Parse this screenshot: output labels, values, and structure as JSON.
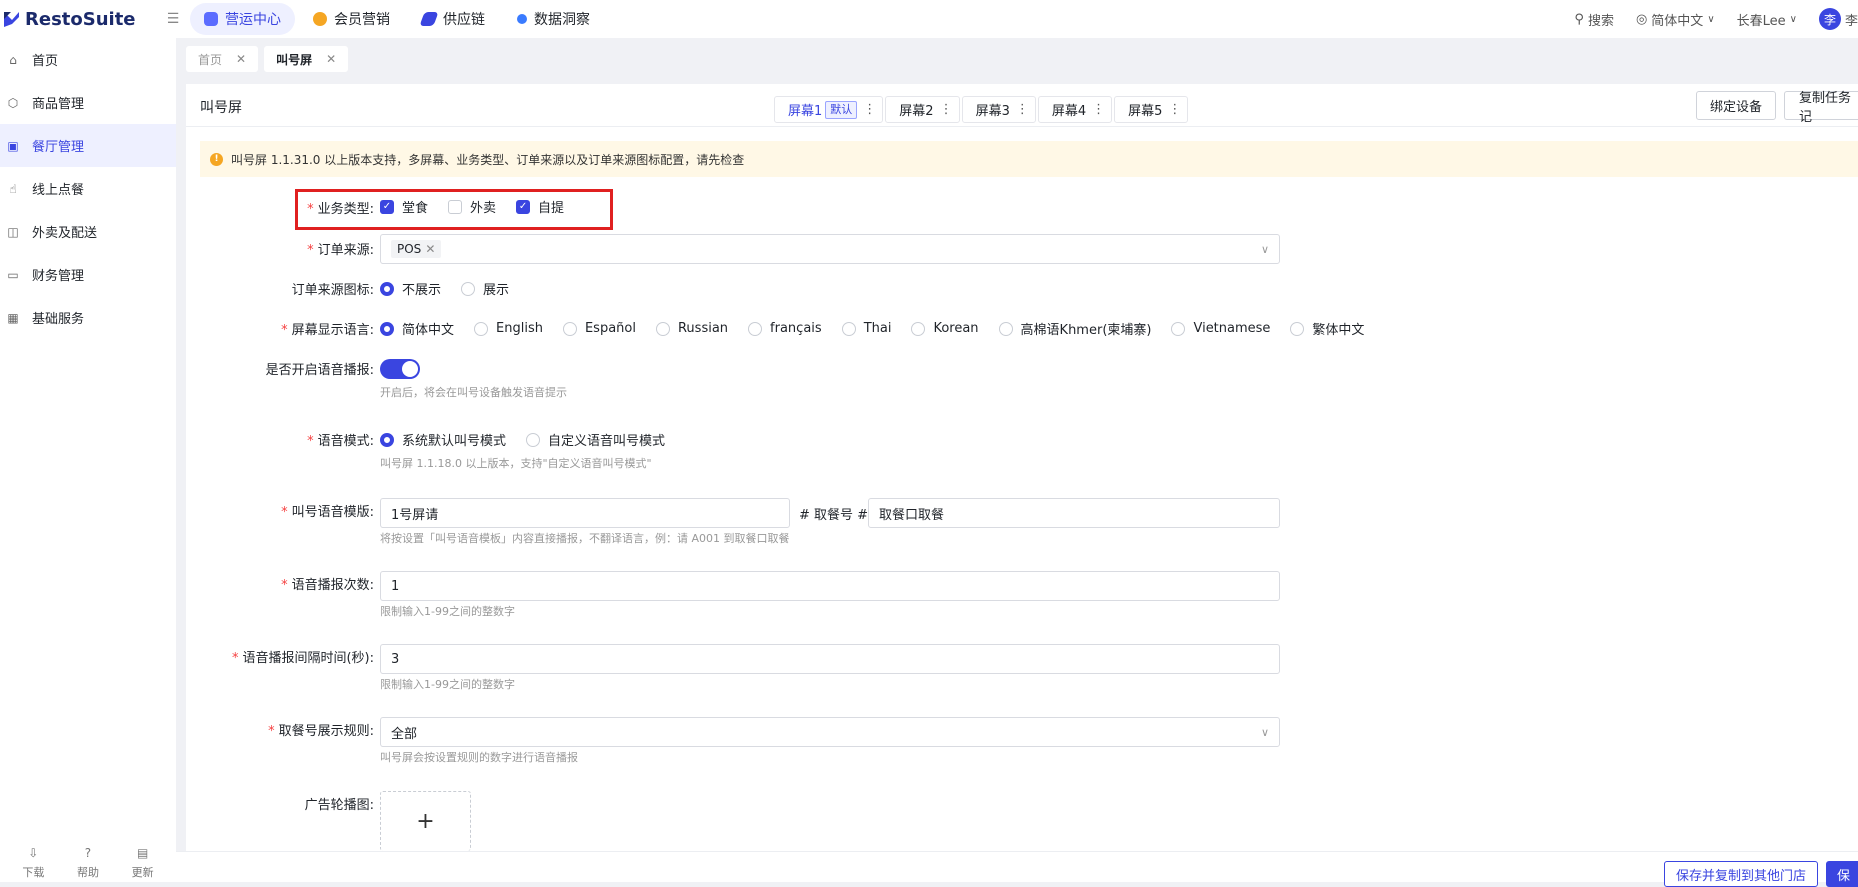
{
  "app": {
    "brand": "RestoSuite"
  },
  "topnav": [
    {
      "label": "营运中心",
      "icon": "operations-icon",
      "color": "#5b6cff"
    },
    {
      "label": "会员营销",
      "icon": "member-icon",
      "color": "#f5a623"
    },
    {
      "label": "供应链",
      "icon": "supply-icon",
      "color": "#3a45e0"
    },
    {
      "label": "数据洞察",
      "icon": "data-icon",
      "color": "#3a7bff"
    }
  ],
  "header": {
    "search": "搜索",
    "language": "简体中文",
    "user": "长春Lee",
    "avatar": "李",
    "avatar_trailing": "李"
  },
  "sidebar": {
    "items": [
      {
        "label": "首页"
      },
      {
        "label": "商品管理"
      },
      {
        "label": "餐厅管理"
      },
      {
        "label": "线上点餐"
      },
      {
        "label": "外卖及配送"
      },
      {
        "label": "财务管理"
      },
      {
        "label": "基础服务"
      }
    ],
    "bottom": [
      {
        "label": "下载"
      },
      {
        "label": "帮助"
      },
      {
        "label": "更新"
      }
    ]
  },
  "page_tabs": [
    {
      "label": "首页"
    },
    {
      "label": "叫号屏"
    }
  ],
  "panel": {
    "title": "叫号屏",
    "screens": [
      {
        "label": "屏幕1",
        "badge": "默认"
      },
      {
        "label": "屏幕2"
      },
      {
        "label": "屏幕3"
      },
      {
        "label": "屏幕4"
      },
      {
        "label": "屏幕5"
      }
    ],
    "bind_device": "绑定设备",
    "copy_task": "复制任务记",
    "notice": "叫号屏 1.1.31.0 以上版本支持，多屏幕、业务类型、订单来源以及订单来源图标配置，请先检查"
  },
  "form": {
    "business_type": {
      "label": "业务类型:",
      "options": [
        "堂食",
        "外卖",
        "自提"
      ]
    },
    "order_source": {
      "label": "订单来源:",
      "tag": "POS"
    },
    "source_icon": {
      "label": "订单来源图标:",
      "options": [
        "不展示",
        "展示"
      ]
    },
    "language": {
      "label": "屏幕显示语言:",
      "options": [
        "简体中文",
        "English",
        "Español",
        "Russian",
        "français",
        "Thai",
        "Korean",
        "高棉语Khmer(柬埔寨)",
        "Vietnamese",
        "繁体中文"
      ]
    },
    "voice": {
      "label": "是否开启语音播报:",
      "hint": "开启后，将会在叫号设备触发语音提示"
    },
    "voice_mode": {
      "label": "语音模式:",
      "options": [
        "系统默认叫号模式",
        "自定义语音叫号模式"
      ],
      "hint": "叫号屏 1.1.18.0 以上版本，支持\"自定义语音叫号模式\""
    },
    "template": {
      "label": "叫号语音模版:",
      "prefix_value": "1号屏请",
      "middle": "# 取餐号 #",
      "suffix_value": "取餐口取餐",
      "hint": "将按设置「叫号语音模板」内容直接播报，不翻译语言，例：请 A001 到取餐口取餐"
    },
    "repeat": {
      "label": "语音播报次数:",
      "value": "1",
      "hint": "限制输入1-99之间的整数字"
    },
    "interval": {
      "label": "语音播报间隔时间(秒):",
      "value": "3",
      "hint": "限制输入1-99之间的整数字"
    },
    "display_rule": {
      "label": "取餐号展示规则:",
      "value": "全部",
      "hint": "叫号屏会按设置规则的数字进行语音播报"
    },
    "carousel": {
      "label": "广告轮播图:"
    }
  },
  "footer": {
    "save_copy": "保存并复制到其他门店",
    "save": "保"
  }
}
